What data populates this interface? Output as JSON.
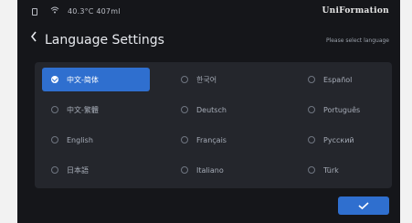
{
  "status_bar": {
    "temperature_text": "40.3°C 407ml",
    "brand": "UniFormation",
    "sd_icon": "sd-card-icon",
    "wifi_icon": "wifi-icon"
  },
  "header": {
    "back_icon": "chevron-left-icon",
    "title": "Language Settings",
    "hint": "Please select language"
  },
  "languages": [
    {
      "label": "中文-简体",
      "selected": true
    },
    {
      "label": "한국어",
      "selected": false
    },
    {
      "label": "Español",
      "selected": false
    },
    {
      "label": "中文-繁體",
      "selected": false
    },
    {
      "label": "Deutsch",
      "selected": false
    },
    {
      "label": "Português",
      "selected": false
    },
    {
      "label": "English",
      "selected": false
    },
    {
      "label": "Français",
      "selected": false
    },
    {
      "label": "Русский",
      "selected": false
    },
    {
      "label": "日本語",
      "selected": false
    },
    {
      "label": "Italiano",
      "selected": false
    },
    {
      "label": "Türk",
      "selected": false
    }
  ],
  "confirm": {
    "icon": "check-icon"
  },
  "colors": {
    "accent": "#2f6fcf",
    "background": "#15161a",
    "panel": "#24262c"
  }
}
